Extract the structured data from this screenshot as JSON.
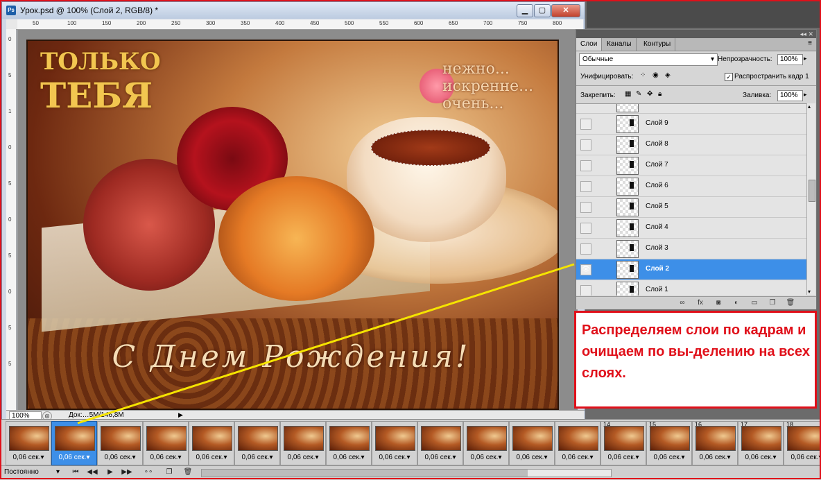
{
  "document": {
    "title": "Урок.psd @ 100% (Слой 2, RGB/8) *",
    "app_icon": "Ps",
    "ruler_h_labels": [
      "50",
      "100",
      "150",
      "200",
      "250",
      "300",
      "350",
      "400",
      "450",
      "500",
      "550",
      "600",
      "650",
      "700",
      "750",
      "800"
    ],
    "ruler_v_labels": [
      "0",
      "5",
      "1",
      "0",
      "5",
      "0",
      "5",
      "0",
      "5",
      "5"
    ],
    "zoom": "100%",
    "doc_info": "Док:…5М/146,8М"
  },
  "artwork": {
    "title_line1": "ТОЛЬКО",
    "title_line2": "ТЕБЯ",
    "sub_line1": "нежно...",
    "sub_line2": "искренне...",
    "sub_line3": "очень...",
    "bottom_text": "С Днем Рождения!"
  },
  "layers_panel": {
    "tabs": [
      "Слои",
      "Каналы",
      "Контуры"
    ],
    "blend_mode": "Обычные",
    "opacity_label": "Непрозрачность:",
    "opacity_value": "100%",
    "unify_label": "Унифицировать:",
    "propagate_label": "Распространить кадр 1",
    "lock_label": "Закрепить:",
    "fill_label": "Заливка:",
    "fill_value": "100%",
    "layers": [
      {
        "name": "Слой 9",
        "visible": false,
        "selected": false
      },
      {
        "name": "Слой 8",
        "visible": false,
        "selected": false
      },
      {
        "name": "Слой 7",
        "visible": false,
        "selected": false
      },
      {
        "name": "Слой 6",
        "visible": false,
        "selected": false
      },
      {
        "name": "Слой 5",
        "visible": false,
        "selected": false
      },
      {
        "name": "Слой 4",
        "visible": false,
        "selected": false
      },
      {
        "name": "Слой 3",
        "visible": false,
        "selected": false
      },
      {
        "name": "Слой 2",
        "visible": true,
        "selected": true
      },
      {
        "name": "Слой 1",
        "visible": false,
        "selected": false
      }
    ],
    "bottom_icons": [
      "link-icon",
      "fx-icon",
      "mask-icon",
      "adjustment-icon",
      "folder-icon",
      "new-layer-icon",
      "trash-icon"
    ]
  },
  "callout": {
    "text": "Распределяем слои по кадрам и очищаем по вы-делению на всех слоях."
  },
  "animation": {
    "frames": [
      {
        "num": "",
        "time": "0,06 сек."
      },
      {
        "num": "",
        "time": "0,06 сек."
      },
      {
        "num": "",
        "time": "0,06 сек."
      },
      {
        "num": "",
        "time": "0,06 сек."
      },
      {
        "num": "",
        "time": "0,06 сек."
      },
      {
        "num": "",
        "time": "0,06 сек."
      },
      {
        "num": "",
        "time": "0,06 сек."
      },
      {
        "num": "",
        "time": "0,06 сек."
      },
      {
        "num": "",
        "time": "0,06 сек."
      },
      {
        "num": "",
        "time": "0,06 сек."
      },
      {
        "num": "",
        "time": "0,06 сек."
      },
      {
        "num": "",
        "time": "0,06 сек."
      },
      {
        "num": "",
        "time": "0,06 сек."
      },
      {
        "num": "14",
        "time": "0,06 сек."
      },
      {
        "num": "15",
        "time": "0,06 сек."
      },
      {
        "num": "16",
        "time": "0,06 сек."
      },
      {
        "num": "17",
        "time": "0,06 сек."
      },
      {
        "num": "18",
        "time": "0,06 сек."
      }
    ],
    "selected_frame": 2,
    "loop": "Постоянно",
    "controls": [
      "first-frame-icon",
      "prev-frame-icon",
      "play-icon",
      "next-frame-icon",
      "tween-icon",
      "duplicate-frame-icon",
      "delete-frame-icon"
    ]
  },
  "colors": {
    "accent_red": "#e0101a",
    "selection_blue": "#3d8fe8",
    "pointer_yellow": "#f5e400"
  }
}
